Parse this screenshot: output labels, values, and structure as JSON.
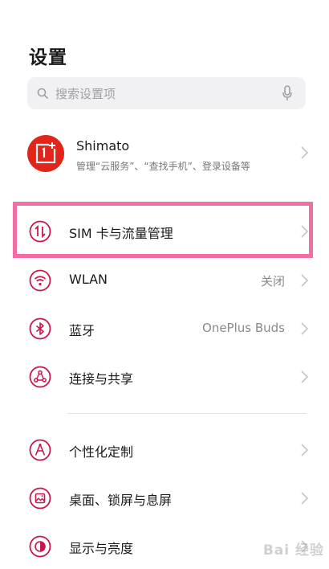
{
  "header": {
    "title": "设置"
  },
  "search": {
    "placeholder": "搜索设置项"
  },
  "account": {
    "name": "Shimato",
    "subtitle": "管理“云服务”、“查找手机”、登录设备等"
  },
  "settings": [
    {
      "label": "SIM 卡与流量管理",
      "value": "",
      "icon": "sim-data-icon",
      "highlighted": true
    },
    {
      "label": "WLAN",
      "value": "关闭",
      "icon": "wifi-icon"
    },
    {
      "label": "蓝牙",
      "value": "OnePlus Buds",
      "icon": "bluetooth-icon"
    },
    {
      "label": "连接与共享",
      "value": "",
      "icon": "connection-share-icon"
    },
    {
      "label": "个性化定制",
      "value": "",
      "icon": "personalization-icon"
    },
    {
      "label": "桌面、锁屏与息屏",
      "value": "",
      "icon": "home-lock-screen-icon"
    },
    {
      "label": "显示与亮度",
      "value": "",
      "icon": "display-brightness-icon"
    }
  ],
  "colors": {
    "accent": "#c8174a",
    "highlight_border": "#f06ea3",
    "avatar_bg": "#e1251b"
  },
  "watermark": "Bai 经验"
}
